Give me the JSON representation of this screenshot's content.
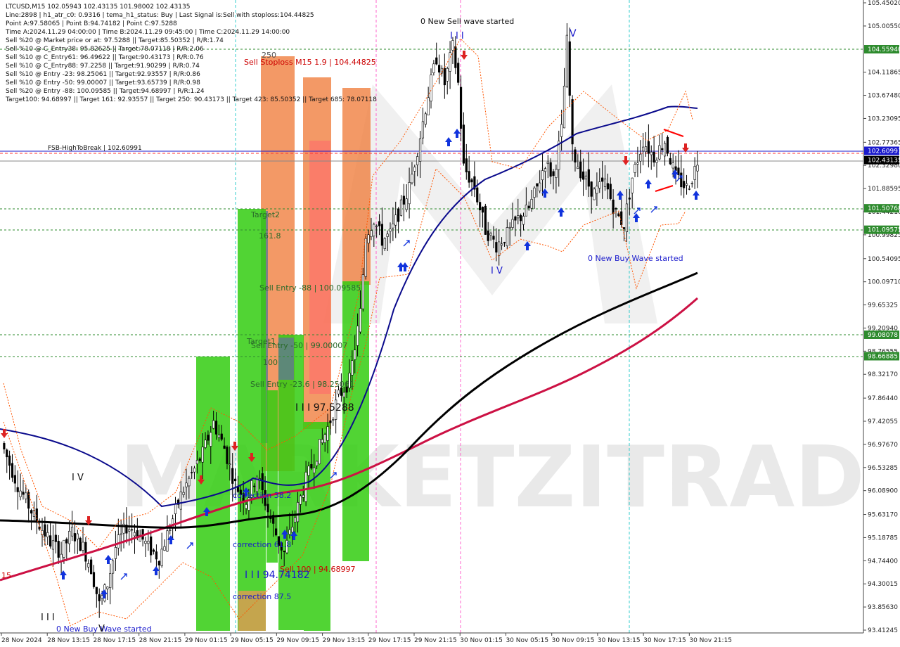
{
  "header": {
    "symbol_line": "LTCUSD,M15  102.05943 102.43135 101.98002 102.43135",
    "info_lines": [
      "Line:2898 | h1_atr_c0: 0.9316 | tema_h1_status: Buy | Last Signal is:Sell with stoploss:104.44825",
      "Point A:97.58065 | Point B:94.74182 | Point C:97.5288",
      "Time A:2024.11.29 04:00:00 | Time B:2024.11.29 09:45:00 | Time C:2024.11.29 14:00:00",
      "Sell %20 @ Market price or at: 97.5288 || Target:85.50352 | R/R:1.74",
      "Sell %10 @ C_Entry38: 95.82625 || Target:78.07118 | R/R:2.06",
      "Sell %10 @ C_Entry61: 96.49622 || Target:90.43173 | R/R:0.76",
      "Sell %10 @ C_Entry88: 97.2258 || Target:91.90299 | R/R:0.74",
      "Sell %10 @ Entry -23: 98.25061 || Target:92.93557 | R/R:0.86",
      "Sell %10 @ Entry -50: 99.00007 || Target:93.65739 | R/R:0.98",
      "Sell %20 @ Entry -88: 100.09585 || Target:94.68997 | R/R:1.24",
      "Target100: 94.68997 || Target 161: 92.93557 || Target 250: 90.43173 || Target 423: 85.50352 || Target 685: 78.07118"
    ]
  },
  "watermark": {
    "brand": "MARKETZITRADE"
  },
  "annotations": {
    "sell_wave": "0 New Sell wave started",
    "buy_wave_right": "0 New Buy Wave started",
    "buy_wave_left": "0 New Buy Wave started",
    "fsb_label": "FSB-HighToBreak | 102.60991",
    "sell_stoploss": "Sell Stoploss M15 1.9 | 104.44825",
    "level_250": "250",
    "target2": "Target2",
    "level_1618": "161.8",
    "sell_entry_88": "Sell Entry -88 | 100.09585",
    "target1": "Target1",
    "sell_entry_50": "Sell Entry -50 | 99.00007",
    "level_100": "100",
    "sell_entry_236": "Sell Entry -23.6 | 98.25061",
    "point_c": "I I I 97.5288",
    "correction_382": "correction 38.2",
    "correction_618": "correction 61.8",
    "correction_875": "correction 87.5",
    "sell_100": "Sell 100 | 94.68997",
    "point_b": "I I I 94.74182",
    "wave_iii_top": "I I I",
    "wave_v_top": "V",
    "wave_iv": "I V",
    "wave_iv_left": "I V",
    "wave_iii_bottom": "I I I",
    "wave_v_bottom": "V",
    "left_15": "15"
  },
  "price_axis": {
    "labels": [
      "105.45020",
      "105.00550",
      "104.11865",
      "103.67480",
      "103.23095",
      "102.77365",
      "102.32980",
      "101.88595",
      "101.44210",
      "100.99825",
      "100.54095",
      "100.09710",
      "99.65325",
      "99.20940",
      "98.76555",
      "98.32170",
      "97.86440",
      "97.42055",
      "96.97670",
      "96.53285",
      "96.08900",
      "95.63170",
      "95.18785",
      "94.74400",
      "94.30015",
      "93.85630",
      "93.41245"
    ],
    "badges": [
      {
        "value": "104.55940",
        "color": "#2e8b2e"
      },
      {
        "value": "102.60991",
        "color": "#1a1acc"
      },
      {
        "value": "102.43135",
        "color": "#000000"
      },
      {
        "value": "101.50768",
        "color": "#2e8b2e"
      },
      {
        "value": "101.09575",
        "color": "#2e8b2e"
      },
      {
        "value": "99.08078",
        "color": "#2e8b2e"
      },
      {
        "value": "98.66885",
        "color": "#2e8b2e"
      }
    ]
  },
  "time_axis": {
    "labels": [
      "28 Nov 2024",
      "28 Nov 13:15",
      "28 Nov 17:15",
      "28 Nov 21:15",
      "29 Nov 01:15",
      "29 Nov 05:15",
      "29 Nov 09:15",
      "29 Nov 13:15",
      "29 Nov 17:15",
      "29 Nov 21:15",
      "30 Nov 01:15",
      "30 Nov 05:15",
      "30 Nov 09:15",
      "30 Nov 13:15",
      "30 Nov 17:15",
      "30 Nov 21:15"
    ]
  },
  "colors": {
    "bull_green": "#2e8b2e",
    "fsb_blue": "#1a1acc",
    "ma_blue": "#0a0a8c",
    "ma_black": "#000000",
    "ma_red": "#cc1144",
    "zone_green": "#33cc11",
    "zone_orange": "#f08040",
    "zone_tan": "#d2a050",
    "zone_slate": "#607890",
    "zone_pink": "#ff6a6a",
    "sell_arrow": "#dd2222",
    "buy_arrow": "#1133dd"
  },
  "chart_data": {
    "type": "candlestick",
    "symbol": "LTCUSD",
    "timeframe": "M15",
    "ylim": [
      93.41245,
      105.4502
    ],
    "ohlc_last": {
      "open": 102.05943,
      "high": 102.43135,
      "low": 101.98002,
      "close": 102.43135
    },
    "key_levels": {
      "fsb_high_to_break": 102.60991,
      "current_price": 102.43135,
      "stoploss": 104.44825,
      "upper_green": 104.5594,
      "green_1": 101.50768,
      "green_2": 101.09575,
      "green_3": 99.08078,
      "green_4": 98.66885
    },
    "path_points": [
      [
        0,
        97.0
      ],
      [
        6,
        96.2
      ],
      [
        12,
        95.6
      ],
      [
        18,
        95.1
      ],
      [
        22,
        94.9
      ],
      [
        26,
        95.3
      ],
      [
        30,
        95.0
      ],
      [
        33,
        94.6
      ],
      [
        36,
        93.9
      ],
      [
        39,
        94.3
      ],
      [
        42,
        95.0
      ],
      [
        46,
        95.4
      ],
      [
        50,
        95.3
      ],
      [
        54,
        95.0
      ],
      [
        58,
        94.8
      ],
      [
        62,
        95.4
      ],
      [
        66,
        96.0
      ],
      [
        70,
        96.4
      ],
      [
        74,
        96.8
      ],
      [
        78,
        97.4
      ],
      [
        82,
        96.9
      ],
      [
        86,
        96.2
      ],
      [
        90,
        95.9
      ],
      [
        94,
        96.4
      ],
      [
        98,
        95.7
      ],
      [
        102,
        95.1
      ],
      [
        104,
        94.9
      ],
      [
        108,
        95.6
      ],
      [
        112,
        96.3
      ],
      [
        116,
        96.8
      ],
      [
        120,
        97.3
      ],
      [
        124,
        97.9
      ],
      [
        128,
        98.2
      ],
      [
        132,
        99.5
      ],
      [
        134,
        101.0
      ],
      [
        137,
        101.3
      ],
      [
        140,
        100.9
      ],
      [
        143,
        101.0
      ],
      [
        146,
        101.4
      ],
      [
        150,
        101.9
      ],
      [
        154,
        102.9
      ],
      [
        157,
        103.7
      ],
      [
        160,
        104.4
      ],
      [
        163,
        103.9
      ],
      [
        166,
        104.6
      ],
      [
        168,
        103.9
      ],
      [
        170,
        102.3
      ],
      [
        174,
        101.9
      ],
      [
        178,
        101.1
      ],
      [
        182,
        100.8
      ],
      [
        186,
        101.0
      ],
      [
        190,
        101.3
      ],
      [
        194,
        101.5
      ],
      [
        197,
        101.9
      ],
      [
        200,
        102.4
      ],
      [
        203,
        102.1
      ],
      [
        206,
        103.0
      ],
      [
        208,
        104.7
      ],
      [
        210,
        102.6
      ],
      [
        214,
        102.1
      ],
      [
        218,
        101.8
      ],
      [
        222,
        102.0
      ],
      [
        226,
        101.4
      ],
      [
        229,
        101.2
      ],
      [
        232,
        102.1
      ],
      [
        236,
        102.8
      ],
      [
        240,
        102.5
      ],
      [
        244,
        102.8
      ],
      [
        248,
        102.1
      ],
      [
        252,
        101.9
      ],
      [
        254,
        102.1
      ],
      [
        256,
        102.43
      ]
    ]
  }
}
